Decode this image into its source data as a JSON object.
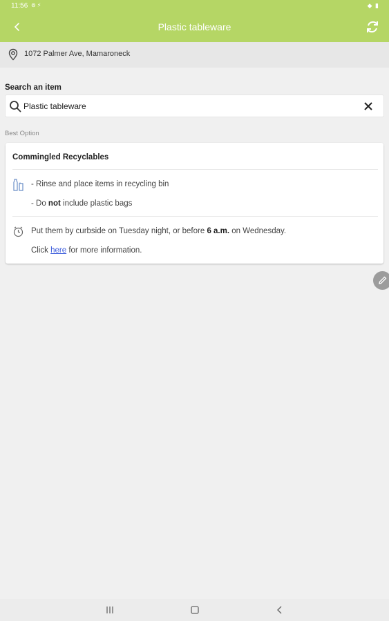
{
  "status_bar": {
    "time": "11:56",
    "indicators": "⊚ ⚡",
    "right_icons": "◆ ▮"
  },
  "app_bar": {
    "title": "Plastic tableware",
    "back_icon": "back-icon",
    "refresh_icon": "refresh-icon",
    "bg_color": "#b5d665"
  },
  "location": {
    "address": "1072 Palmer Ave, Mamaroneck",
    "icon": "location-pin-icon"
  },
  "search": {
    "label": "Search an item",
    "value": "Plastic tableware",
    "icon": "search-icon",
    "clear_icon": "close-icon"
  },
  "results": {
    "section_label": "Best Option",
    "card": {
      "category": "Commingled Recyclables",
      "instruction_1": "- Rinse and place items in recycling bin",
      "instruction_2_pre": "- Do ",
      "instruction_2_bold": "not",
      "instruction_2_post": " include plastic bags",
      "schedule_pre": "Put them by curbside on Tuesday night, or before ",
      "schedule_bold": "6 a.m.",
      "schedule_post": " on Wednesday.",
      "info_pre": "Click ",
      "info_link": "here",
      "info_post": " for more information.",
      "link_color": "#3b5bdb"
    }
  },
  "fab": {
    "icon": "edit-pencil-icon"
  },
  "nav_bar": {
    "recents_icon": "recents-icon",
    "home_icon": "home-icon",
    "back_icon": "nav-back-icon"
  }
}
